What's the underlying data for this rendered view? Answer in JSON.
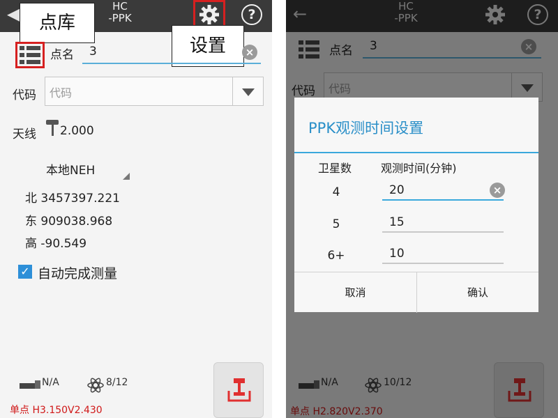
{
  "left": {
    "header": {
      "title_line1": "HC",
      "title_line2": "-PPK"
    },
    "callouts": {
      "point_library": "点库",
      "settings": "设置"
    },
    "point_name": {
      "label": "点名",
      "value": "3"
    },
    "code": {
      "label": "代码",
      "placeholder": "代码"
    },
    "antenna": {
      "label": "天线",
      "value": "2.000"
    },
    "coord_system": "本地NEH",
    "coords": [
      {
        "label": "北",
        "value": "3457397.221"
      },
      {
        "label": "东",
        "value": "909038.968"
      },
      {
        "label": "高",
        "value": "-90.549"
      }
    ],
    "auto_complete": {
      "label": "自动完成测量",
      "checked": true
    },
    "status": {
      "signal": "N/A",
      "satellites": "8/12",
      "solution": "单点 H3.150V2.430"
    }
  },
  "right": {
    "header": {
      "title_line1": "HC",
      "title_line2": "-PPK"
    },
    "point_name": {
      "label": "点名",
      "value": "3"
    },
    "code": {
      "label": "代码",
      "placeholder": "代码"
    },
    "status": {
      "signal": "N/A",
      "satellites": "10/12",
      "solution": "单点 H2.820V2.370"
    },
    "dialog": {
      "title": "PPK观测时间设置",
      "col_satellites": "卫星数",
      "col_time": "观测时间(分钟)",
      "rows": [
        {
          "count": "4",
          "minutes": "20"
        },
        {
          "count": "5",
          "minutes": "15"
        },
        {
          "count": "6+",
          "minutes": "10"
        }
      ],
      "cancel": "取消",
      "confirm": "确认"
    }
  },
  "colors": {
    "accent": "#3aa8dc",
    "highlight_red": "#d62020",
    "status_red": "#d01818"
  }
}
